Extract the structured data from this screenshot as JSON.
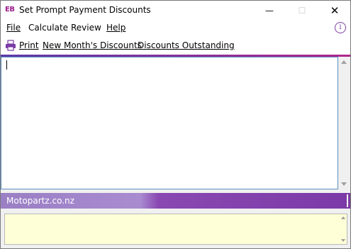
{
  "window": {
    "app_icon_text": "EB",
    "title": "Set Prompt Payment Discounts",
    "minimize_glyph": "—",
    "maximize_glyph": "☐",
    "close_glyph": "✕"
  },
  "menu": {
    "items": [
      {
        "label": "File"
      },
      {
        "label": "Calculate"
      },
      {
        "label": "Review"
      },
      {
        "label": "Help"
      }
    ],
    "info_glyph": "i"
  },
  "toolbar": {
    "print_label": "Print",
    "new_month_label": "New Month's Discounts",
    "outstanding_label": "Discounts Outstanding"
  },
  "editor": {
    "content": ""
  },
  "status": {
    "company": "Motopartz.co.nz"
  },
  "notes": {
    "content": ""
  },
  "colors": {
    "accent_purple": "#7b3aa6",
    "status_light": "#a98bd0",
    "notes_bg": "#fefed7",
    "editor_border": "#5a8fc0"
  },
  "icons": [
    "app-eb-icon",
    "minimize-icon",
    "maximize-icon",
    "close-icon",
    "info-icon",
    "printer-icon",
    "scroll-up-icon",
    "scroll-down-icon"
  ]
}
